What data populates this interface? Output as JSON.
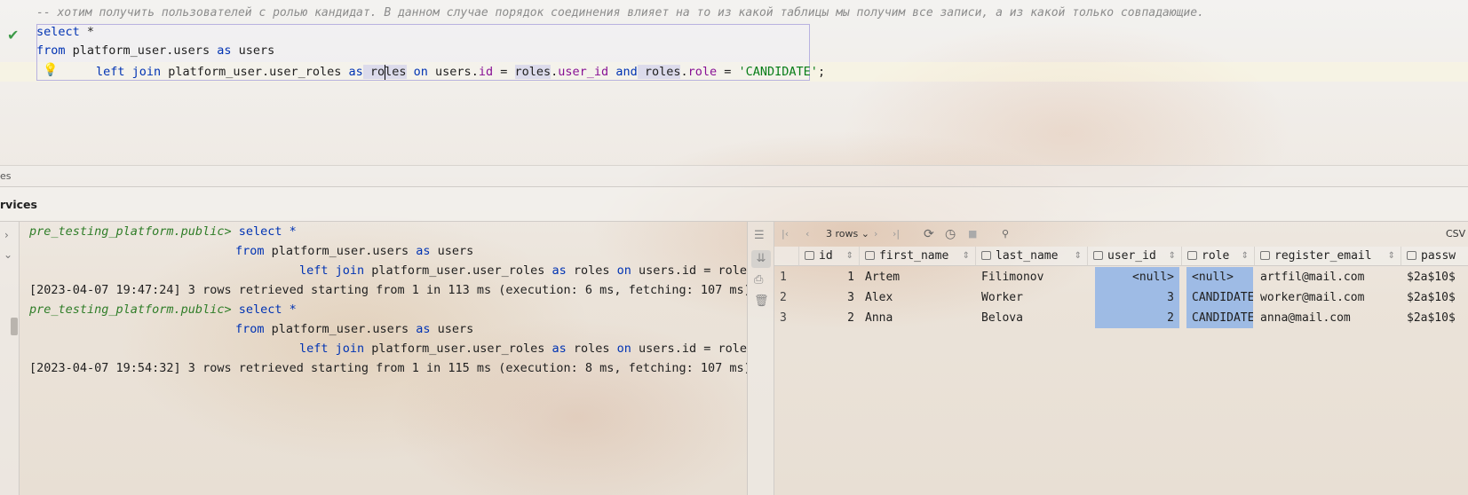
{
  "editor": {
    "comment": "-- хотим получить пользователей с ролью кандидат. В данном случае порядок соединения влияет на то из какой таблицы мы получим все записи, а из какой только совпадающие.",
    "tokens": {
      "select": "select",
      "star": " *",
      "from": "from",
      "from_table": " platform_user.users ",
      "as": "as",
      "users": " users",
      "left_join": "left join",
      "join_table": " platform_user.user_roles ",
      "as2": "as",
      "ro": " ro",
      "les": "les",
      "on": " on",
      "users_ref": " users",
      "dot_id": ".",
      "id": "id",
      "eq1": " = ",
      "roles_ref": "roles",
      "dot1": ".",
      "user_id": "user_id",
      "and": " and",
      "roles_ref2": " roles",
      "dot2": ".",
      "role": "role",
      "eq2": " = ",
      "value": "'CANDIDATE'",
      "semi": ";"
    }
  },
  "panels": {
    "status_text": "es",
    "services_title": "rvices"
  },
  "console": {
    "lines": [
      {
        "prompt": "pre_testing_platform.public>",
        "code": " select *"
      },
      {
        "code": "from platform_user.users as users"
      },
      {
        "code": "left join platform_user.user_roles as roles on users.id = roles"
      },
      {
        "log": "[2023-04-07 19:47:24] 3 rows retrieved starting from 1 in 113 ms (execution: 6 ms, fetching: 107 ms)"
      },
      {
        "prompt": "pre_testing_platform.public>",
        "code": " select *"
      },
      {
        "code": "from platform_user.users as users"
      },
      {
        "code": "left join platform_user.user_roles as roles on users.id = roles"
      },
      {
        "log": "[2023-04-07 19:54:32] 3 rows retrieved starting from 1 in 115 ms (execution: 8 ms, fetching: 107 ms)"
      }
    ]
  },
  "grid_toolbar": {
    "rows_label": "3 rows",
    "export_format": "CSV"
  },
  "grid": {
    "columns": [
      "id",
      "first_name",
      "last_name",
      "user_id",
      "role",
      "register_email",
      "passw"
    ],
    "rows": [
      {
        "n": "1",
        "id": "1",
        "first_name": "Artem",
        "last_name": "Filimonov",
        "user_id": "<null>",
        "role": "<null>",
        "email": "artfil@mail.com",
        "pass": "$2a$10$"
      },
      {
        "n": "2",
        "id": "3",
        "first_name": "Alex",
        "last_name": "Worker",
        "user_id": "3",
        "role": "CANDIDATE",
        "email": "worker@mail.com",
        "pass": "$2a$10$"
      },
      {
        "n": "3",
        "id": "2",
        "first_name": "Anna",
        "last_name": "Belova",
        "user_id": "2",
        "role": "CANDIDATE",
        "email": "anna@mail.com",
        "pass": "$2a$10$"
      }
    ]
  },
  "icons": {
    "check": "checkmark-icon",
    "bulb": "lightbulb-icon"
  }
}
